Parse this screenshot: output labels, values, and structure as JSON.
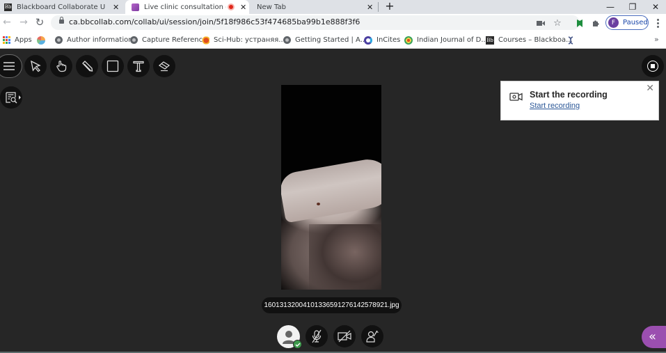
{
  "browser": {
    "tabs": [
      {
        "title": "Blackboard Collaborate Ultra – D",
        "favicon": "blackboard-icon",
        "active": false
      },
      {
        "title": "Live clinic consultation - Bb C",
        "favicon": "collaborate-icon",
        "active": true,
        "recording": true
      },
      {
        "title": "New Tab",
        "favicon": "",
        "active": false
      }
    ],
    "close_glyph": "✕",
    "new_tab_glyph": "+",
    "window_controls": {
      "minimize": "—",
      "restore": "❐",
      "close": "✕"
    },
    "address_bar": {
      "url": "ca.bbcollab.com/collab/ui/session/join/5f18f986c53f474685ba99b1e888f3f6",
      "secure": true
    },
    "profile": {
      "initial": "F",
      "status": "Paused"
    },
    "bookmarks": [
      {
        "label": "Apps",
        "icon": "apps-grid-icon"
      },
      {
        "label": "",
        "icon": "colorful-circle-icon"
      },
      {
        "label": "Author information",
        "icon": "globe-icon"
      },
      {
        "label": "Capture Reference",
        "icon": "globe-icon"
      },
      {
        "label": "Sci-Hub: устраняя...",
        "icon": "scihub-icon"
      },
      {
        "label": "Getting Started | A...",
        "icon": "globe-icon"
      },
      {
        "label": "InCites",
        "icon": "incites-icon"
      },
      {
        "label": "Indian Journal of D...",
        "icon": "journal-icon"
      },
      {
        "label": "Courses – Blackboa...",
        "icon": "blackboard-icon"
      },
      {
        "label": "",
        "icon": "dna-icon"
      }
    ],
    "bookmarks_overflow": "»"
  },
  "collaborate": {
    "toolbar": [
      {
        "name": "menu",
        "icon": "hamburger-icon"
      },
      {
        "name": "select",
        "icon": "pointer-arrow-icon"
      },
      {
        "name": "pan",
        "icon": "hand-icon"
      },
      {
        "name": "pencil",
        "icon": "pencil-icon"
      },
      {
        "name": "shape",
        "icon": "rectangle-icon"
      },
      {
        "name": "text",
        "icon": "text-icon"
      },
      {
        "name": "eraser",
        "icon": "eraser-icon"
      }
    ],
    "side_tool": {
      "name": "zoom-view",
      "icon": "document-search-icon"
    },
    "recording_toast": {
      "title": "Start the recording",
      "link": "Start recording",
      "close": "✕"
    },
    "shared_file": {
      "filename": "16013132004101336591276142578921.jpg"
    },
    "controls": [
      {
        "name": "my-status",
        "icon": "avatar-icon",
        "status": "present"
      },
      {
        "name": "microphone",
        "icon": "mic-off-icon",
        "state": "off"
      },
      {
        "name": "camera",
        "icon": "camera-off-icon",
        "state": "off"
      },
      {
        "name": "hand-raise",
        "icon": "raise-hand-icon",
        "state": "off"
      }
    ],
    "panel_toggle_glyph": "«",
    "colors": {
      "accent": "#9b4fb0",
      "stage_bg": "#262626",
      "button_bg": "#111111",
      "status_ok": "#3d9a4c"
    }
  }
}
